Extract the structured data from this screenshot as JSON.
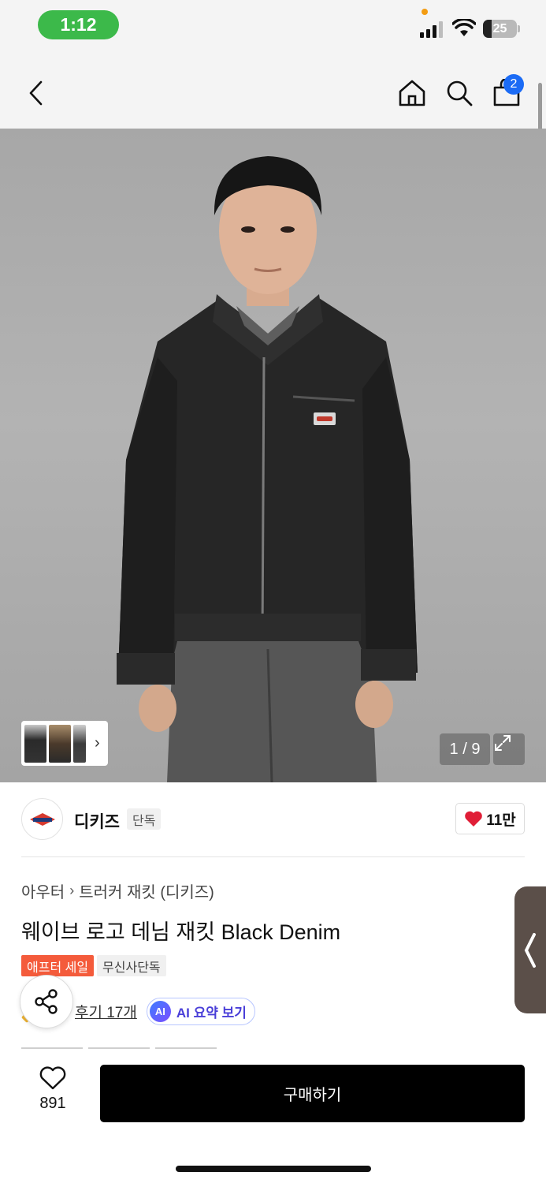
{
  "status_bar": {
    "time": "1:12",
    "battery_level": "25",
    "battery_fraction": 0.25,
    "icons": [
      "signal-icon",
      "wifi-icon",
      "battery-icon"
    ]
  },
  "header": {
    "icons": [
      "back-icon",
      "home-icon",
      "search-icon",
      "shopping-bag-icon"
    ],
    "cart_count": "2"
  },
  "gallery": {
    "page_current": "1",
    "page_total": "9",
    "page_label": "1 / 9",
    "icons": [
      "thumbnail-chevron-icon",
      "expand-icon"
    ]
  },
  "brand": {
    "name": "디키즈",
    "tag": "단독",
    "like_count": "11만",
    "heart_color": "#e01e37"
  },
  "product": {
    "category": "아우터",
    "subcategory": "트러커 재킷 (디키즈)",
    "title": "웨이브 로고 데님 재킷 Black Denim",
    "tags": [
      "애프터 세일",
      "무신사단독"
    ],
    "review_link": "후기 17개",
    "ai_badge": "AI",
    "ai_summary_label": "AI 요약 보기",
    "sale_tag_color": "#f45b3b"
  },
  "bottom_bar": {
    "like_count": "891",
    "buy_label": "구매하기"
  },
  "colors": {
    "accent_blue": "#1b6bf5",
    "status_green": "#3cb94a",
    "buy_button": "#000000"
  }
}
